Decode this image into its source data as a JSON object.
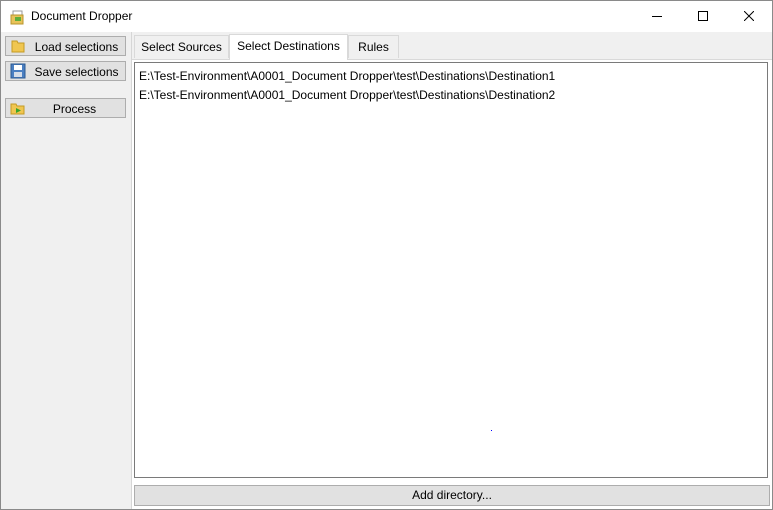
{
  "window": {
    "title": "Document Dropper"
  },
  "sidebar": {
    "load_label": "Load selections",
    "save_label": "Save selections",
    "process_label": "Process"
  },
  "tabs": [
    {
      "label": "Select Sources",
      "active": false
    },
    {
      "label": "Select Destinations",
      "active": true
    },
    {
      "label": "Rules",
      "active": false
    }
  ],
  "destinations": [
    "E:\\Test-Environment\\A0001_Document Dropper\\test\\Destinations\\Destination1",
    "E:\\Test-Environment\\A0001_Document Dropper\\test\\Destinations\\Destination2"
  ],
  "add_button_label": "Add directory...",
  "icons": {
    "app": "document-dropper-icon",
    "load": "folder-open-icon",
    "save": "floppy-disk-icon",
    "process": "folder-play-icon",
    "minimize": "minimize-icon",
    "maximize": "maximize-icon",
    "close": "close-icon"
  }
}
